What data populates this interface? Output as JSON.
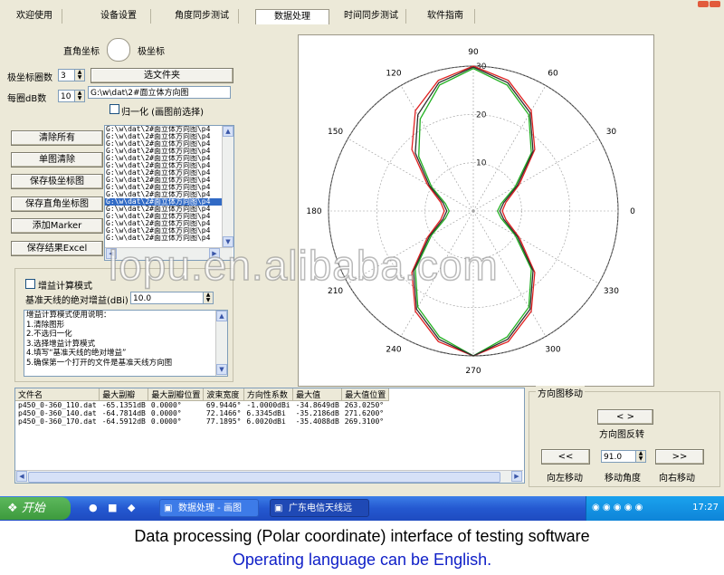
{
  "window": {
    "close_colors": [
      "#e25b3c",
      "#e25b3c"
    ]
  },
  "tabs": [
    {
      "label": "欢迎使用",
      "active": false
    },
    {
      "label": "设备设置",
      "active": false
    },
    {
      "label": "角度同步测试",
      "active": false
    },
    {
      "label": "数据处理",
      "active": true
    },
    {
      "label": "时间同步测试",
      "active": false
    },
    {
      "label": "软件指南",
      "active": false
    }
  ],
  "coord_toggle": {
    "left_label": "直角坐标",
    "right_label": "极坐标"
  },
  "polar_circles": {
    "label": "极坐标圈数",
    "value": "3"
  },
  "db_per_circle": {
    "label": "每圈dB数",
    "value": "10"
  },
  "select_folder_button": "选文件夹",
  "folder_path": "G:\\w\\dat\\2#面立体方向图",
  "normalize": {
    "label": "归一化 (画图前选择)",
    "checked": false
  },
  "action_buttons": [
    "清除所有",
    "单图清除",
    "保存极坐标图",
    "保存直角坐标图",
    "添加Marker",
    "保存结果Excel"
  ],
  "file_list": {
    "items": [
      "G:\\w\\dat\\2#面立体方向图\\p4",
      "G:\\w\\dat\\2#面立体方向图\\p4",
      "G:\\w\\dat\\2#面立体方向图\\p4",
      "G:\\w\\dat\\2#面立体方向图\\p4",
      "G:\\w\\dat\\2#面立体方向图\\p4",
      "G:\\w\\dat\\2#面立体方向图\\p4",
      "G:\\w\\dat\\2#面立体方向图\\p4",
      "G:\\w\\dat\\2#面立体方向图\\p4",
      "G:\\w\\dat\\2#面立体方向图\\p4",
      "G:\\w\\dat\\2#面立体方向图\\p4",
      "G:\\w\\dat\\2#面立体方向图\\p4",
      "G:\\w\\dat\\2#面立体方向图\\p4",
      "G:\\w\\dat\\2#面立体方向图\\p4",
      "G:\\w\\dat\\2#面立体方向图\\p4",
      "G:\\w\\dat\\2#面立体方向图\\p4",
      "G:\\w\\dat\\2#面立体方向图\\p4"
    ],
    "selected_index": 10
  },
  "gain_mode": {
    "checkbox_label": "增益计算模式",
    "ref_gain_label": "基准天线的绝对增益(dBi)",
    "ref_gain_value": "10.0",
    "instructions": [
      "增益计算模式使用说明：",
      "1.清除图形",
      "2.不选归一化",
      "3.选择增益计算模式",
      "4.填写“基准天线的绝对增益”",
      "5.确保第一个打开的文件是基准天线方向图"
    ]
  },
  "results_table": {
    "headers": [
      "文件名",
      "最大副瓣",
      "最大副瓣位置",
      "波束宽度",
      "方向性系数",
      "最大值",
      "最大值位置"
    ],
    "rows": [
      [
        "p450_0-360_110.dat",
        "-65.1351dB",
        "0.0000°",
        "69.9446°",
        "-1.0000dBi",
        "-34.8649dB",
        "263.0250°"
      ],
      [
        "p450_0-360_140.dat",
        "-64.7814dB",
        "0.0000°",
        "72.1466°",
        "6.3345dBi",
        "-35.2186dB",
        "271.6200°"
      ],
      [
        "p450_0-360_170.dat",
        "-64.5912dB",
        "0.0000°",
        "77.1895°",
        "6.0020dBi",
        "-35.4088dB",
        "269.3100°"
      ]
    ]
  },
  "pattern_move": {
    "title": "方向图移动",
    "flip_button": "< >",
    "flip_label": "方向图反转",
    "left_button": "<<",
    "left_label": "向左移动",
    "angle_value": "91.0",
    "angle_label": "移动角度",
    "right_button": ">>",
    "right_label": "向右移动"
  },
  "chart_data": {
    "type": "polar",
    "angle_labels": [
      "0",
      "30",
      "60",
      "90",
      "120",
      "150",
      "180",
      "210",
      "240",
      "270",
      "300",
      "330"
    ],
    "radial_labels": [
      "10",
      "20",
      "30"
    ],
    "radial_range": [
      0,
      30
    ],
    "grid": true,
    "series": [
      {
        "color": "#e02020",
        "angles_deg": [
          0,
          15,
          30,
          45,
          60,
          75,
          90,
          105,
          120,
          135,
          150,
          165,
          180,
          195,
          210,
          225,
          240,
          255,
          270,
          285,
          300,
          315,
          330,
          345
        ],
        "values": [
          6,
          7,
          11,
          18,
          24,
          28,
          30,
          28,
          24,
          18,
          11,
          7,
          6,
          7,
          11,
          18,
          24,
          28,
          30,
          28,
          24,
          18,
          11,
          7
        ]
      },
      {
        "color": "#20b020",
        "angles_deg": [
          0,
          15,
          30,
          45,
          60,
          75,
          90,
          105,
          120,
          135,
          150,
          165,
          180,
          195,
          210,
          225,
          240,
          255,
          270,
          285,
          300,
          315,
          330,
          345
        ],
        "values": [
          5,
          6,
          10,
          17,
          23,
          27,
          29.5,
          27,
          22,
          16,
          10,
          6,
          5,
          6,
          10,
          17,
          23,
          27,
          30,
          27,
          23,
          17,
          10,
          6
        ]
      },
      {
        "color": "#303030",
        "angles_deg": [
          0,
          15,
          30,
          45,
          60,
          75,
          90,
          105,
          120,
          135,
          150,
          165,
          180,
          195,
          210,
          225,
          240,
          255,
          270,
          285,
          300,
          315,
          330,
          345
        ],
        "values": [
          5.5,
          6.5,
          10.5,
          17.5,
          23.5,
          27.5,
          29.8,
          27.5,
          23,
          17,
          10.5,
          6.5,
          5.5,
          6.5,
          10.5,
          17.5,
          23.5,
          27.5,
          30,
          27.5,
          23.5,
          17.5,
          10.5,
          6.5
        ]
      }
    ]
  },
  "taskbar": {
    "start_label": "开始",
    "tasks": [
      "数据处理 - 画图",
      "广东电信天线远场..."
    ],
    "clock": "17:27"
  },
  "watermark": "lopu.en.alibaba.com",
  "captions": {
    "line1": "Data processing (Polar coordinate) interface of testing software",
    "line2": "Operating language can be English."
  }
}
